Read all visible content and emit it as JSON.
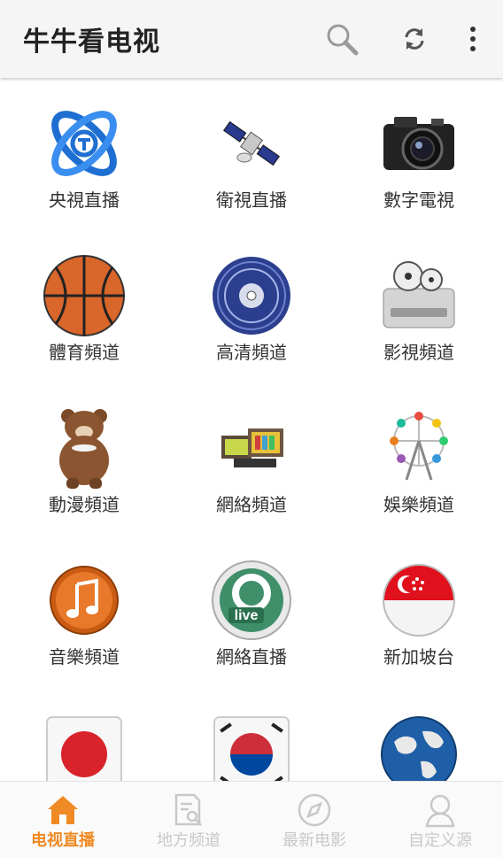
{
  "app": {
    "title": "牛牛看电视"
  },
  "toolbar": {
    "search_icon": "search-icon",
    "refresh_icon": "refresh-icon",
    "more_icon": "more-vert-icon"
  },
  "channels": [
    {
      "label": "央視直播",
      "icon": "cctv-logo-icon"
    },
    {
      "label": "衛視直播",
      "icon": "satellite-icon"
    },
    {
      "label": "數字電視",
      "icon": "camera-icon"
    },
    {
      "label": "體育頻道",
      "icon": "basketball-icon"
    },
    {
      "label": "高清頻道",
      "icon": "disc-icon"
    },
    {
      "label": "影視頻道",
      "icon": "film-reel-icon"
    },
    {
      "label": "動漫頻道",
      "icon": "bear-icon"
    },
    {
      "label": "網絡頻道",
      "icon": "tv-sets-icon"
    },
    {
      "label": "娛樂頻道",
      "icon": "ferris-wheel-icon"
    },
    {
      "label": "音樂頻道",
      "icon": "music-note-icon"
    },
    {
      "label": "網絡直播",
      "icon": "live-icon"
    },
    {
      "label": "新加坡台",
      "icon": "singapore-flag-icon"
    },
    {
      "label": "",
      "icon": "japan-flag-icon"
    },
    {
      "label": "",
      "icon": "korea-flag-icon"
    },
    {
      "label": "",
      "icon": "globe-icon"
    }
  ],
  "bottom_nav": [
    {
      "label": "电视直播",
      "icon": "home-icon",
      "active": true
    },
    {
      "label": "地方频道",
      "icon": "document-search-icon",
      "active": false
    },
    {
      "label": "最新电影",
      "icon": "compass-icon",
      "active": false
    },
    {
      "label": "自定义源",
      "icon": "user-icon",
      "active": false
    }
  ],
  "colors": {
    "accent": "#f08a24",
    "inactive": "#c8c8c8",
    "appbar": "#f5f5f5"
  }
}
